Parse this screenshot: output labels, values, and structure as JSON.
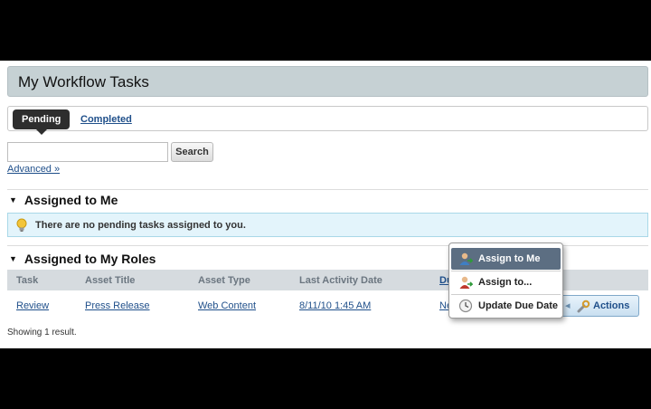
{
  "header": {
    "title": "My Workflow Tasks"
  },
  "tabs": {
    "pending": "Pending",
    "completed": "Completed"
  },
  "search": {
    "value": "",
    "button": "Search",
    "advanced": "Advanced »"
  },
  "assigned_to_me": {
    "heading": "Assigned to Me",
    "message": "There are no pending tasks assigned to you."
  },
  "assigned_to_roles": {
    "heading": "Assigned to My Roles",
    "columns": [
      "Task",
      "Asset Title",
      "Asset Type",
      "Last Activity Date",
      "Du"
    ],
    "rows": [
      {
        "task": "Review",
        "asset_title": "Press Release",
        "asset_type": "Web Content",
        "last_activity": "8/11/10 1:45 AM",
        "due": "Ne"
      }
    ],
    "showing": "Showing 1 result."
  },
  "actions": {
    "label": "Actions"
  },
  "actions_menu": {
    "items": [
      {
        "label": "Assign to Me",
        "icon": "user-assign-icon"
      },
      {
        "label": "Assign to...",
        "icon": "user-assign-to-icon"
      },
      {
        "label": "Update Due Date",
        "icon": "clock-icon"
      }
    ]
  },
  "colors": {
    "title_bar": "#c6d1d4",
    "info_bg": "#e3f4fb",
    "link": "#1f4f8a",
    "menu_active": "#5c6e82"
  }
}
